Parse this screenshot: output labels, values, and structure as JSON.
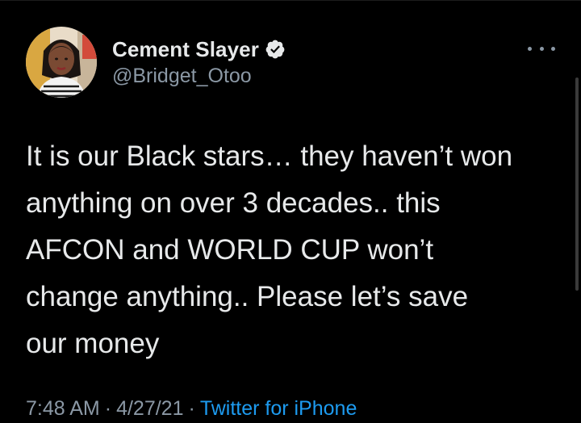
{
  "tweet": {
    "author": {
      "display_name": "Cement Slayer",
      "handle": "@Bridget_Otoo",
      "verified": true,
      "avatar_icon": "profile-photo"
    },
    "text_lines": [
      "It is our Black stars… they haven’t won",
      "anything on over 3 decades.. this",
      "AFCON and WORLD CUP won’t",
      "change anything.. Please let’s save",
      "our money"
    ],
    "time": "7:48 AM",
    "date": "4/27/21",
    "separator": "·",
    "source": "Twitter for iPhone",
    "more_icon": "more-horizontal-icon"
  },
  "colors": {
    "background": "#000000",
    "primary_text": "#e7e9ea",
    "secondary_text": "#8b98a5",
    "link": "#1d9bf0",
    "verified_badge": "#e7e9ea"
  }
}
